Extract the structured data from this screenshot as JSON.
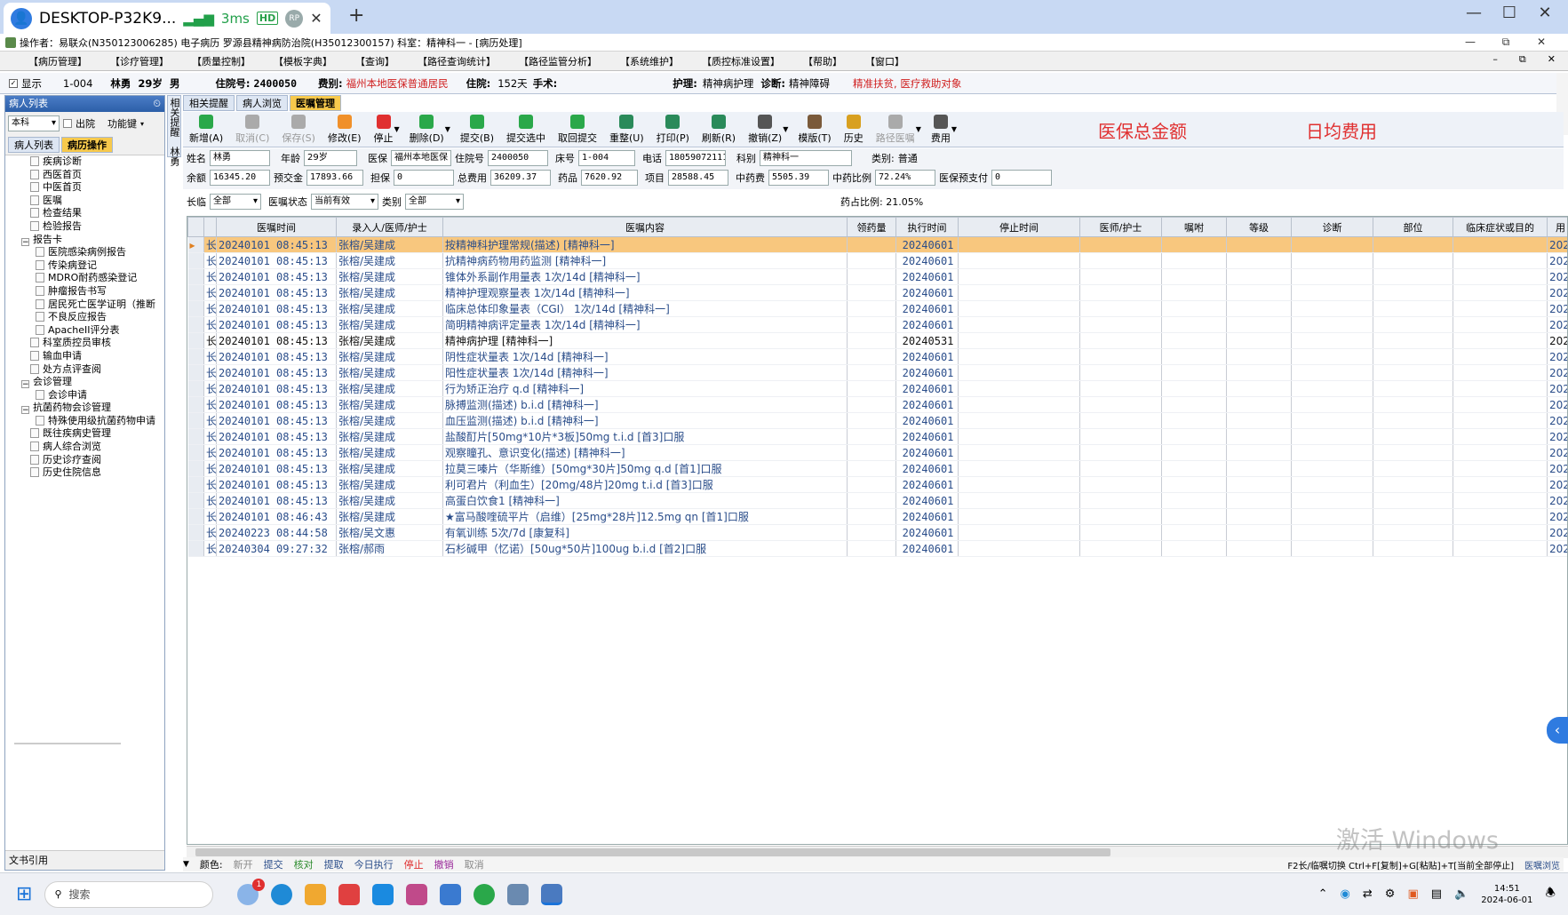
{
  "rdp": {
    "host": "DESKTOP-P32K9...",
    "ping": "3ms",
    "hd": "HD",
    "rp": "RP",
    "close": "✕",
    "add": "+"
  },
  "app_title": "操作者：易联众(N350123006285) 电子病历  罗源县精神病防治院(H35012300157)  科室：精神科一 - [病历处理]",
  "menu": [
    "【病历管理】",
    "【诊疗管理】",
    "【质量控制】",
    "【模板字典】",
    "【查询】",
    "【路径查询统计】",
    "【路径监管分析】",
    "【系统维护】",
    "【质控标准设置】",
    "【帮助】",
    "【窗口】"
  ],
  "patient_bar": {
    "show": "显示",
    "bed": "1-004",
    "name": "林勇",
    "age": "29岁",
    "sex": "男",
    "admission_no_label": "住院号:",
    "admission_no": "2400050",
    "fee_type_label": "费别:",
    "fee_type": "福州本地医保普通居民",
    "stay_label": "住院:",
    "stay": "152天",
    "surgery_label": "手术:",
    "nursing_label": "护理:",
    "nursing": "精神病护理",
    "diag_label": "诊断:",
    "diag": "精神障碍",
    "alert": "精准扶贫, 医疗救助对象"
  },
  "left": {
    "header": "病人列表",
    "dept_select": "本科",
    "discharged": "出院",
    "func_btn": "功能键",
    "tabs": [
      "病人列表",
      "病历操作"
    ],
    "tree": [
      {
        "label": "疾病诊断",
        "level": 1
      },
      {
        "label": "西医首页",
        "level": 1
      },
      {
        "label": "中医首页",
        "level": 1
      },
      {
        "label": "医嘱",
        "level": 1
      },
      {
        "label": "检查结果",
        "level": 1
      },
      {
        "label": "检验报告",
        "level": 1
      },
      {
        "label": "报告卡",
        "level": 0
      },
      {
        "label": "医院感染病例报告",
        "level": 2
      },
      {
        "label": "传染病登记",
        "level": 2
      },
      {
        "label": "MDRO耐药感染登记",
        "level": 2
      },
      {
        "label": "肿瘤报告书写",
        "level": 2
      },
      {
        "label": "居民死亡医学证明（推断",
        "level": 2
      },
      {
        "label": "不良反应报告",
        "level": 2
      },
      {
        "label": "ApacheII评分表",
        "level": 2
      },
      {
        "label": "科室质控员审核",
        "level": 1
      },
      {
        "label": "输血申请",
        "level": 1
      },
      {
        "label": "处方点评查阅",
        "level": 1
      },
      {
        "label": "会诊管理",
        "level": 0
      },
      {
        "label": "会诊申请",
        "level": 2
      },
      {
        "label": "抗菌药物会诊管理",
        "level": 0
      },
      {
        "label": "特殊使用级抗菌药物申请",
        "level": 2
      },
      {
        "label": "既往疾病史管理",
        "level": 1
      },
      {
        "label": "病人综合浏览",
        "level": 1
      },
      {
        "label": "历史诊疗查阅",
        "level": 1
      },
      {
        "label": "历史住院信息",
        "level": 1
      }
    ],
    "footer": "文书引用"
  },
  "vertical_tab": "相关提醒",
  "vertical_tab2": "林勇",
  "tabs": [
    "相关提醒",
    "病人浏览",
    "医嘱管理"
  ],
  "toolbar": [
    {
      "label": "新增(A)",
      "color": "#2aa84a",
      "disabled": false,
      "dd": false
    },
    {
      "label": "取消(C)",
      "color": "#aaaaaa",
      "disabled": true,
      "dd": false
    },
    {
      "label": "保存(S)",
      "color": "#aaaaaa",
      "disabled": true,
      "dd": false
    },
    {
      "label": "修改(E)",
      "color": "#f0902a",
      "disabled": false,
      "dd": false
    },
    {
      "label": "停止",
      "color": "#e03030",
      "disabled": false,
      "dd": true
    },
    {
      "label": "删除(D)",
      "color": "#2aa84a",
      "disabled": false,
      "dd": true
    },
    {
      "label": "提交(B)",
      "color": "#2aa84a",
      "disabled": false,
      "dd": false
    },
    {
      "label": "提交选中",
      "color": "#2aa84a",
      "disabled": false,
      "dd": false
    },
    {
      "label": "取回提交",
      "color": "#2aa84a",
      "disabled": false,
      "dd": false
    },
    {
      "label": "重整(U)",
      "color": "#2a8a5a",
      "disabled": false,
      "dd": false
    },
    {
      "label": "打印(P)",
      "color": "#2a8a5a",
      "disabled": false,
      "dd": false
    },
    {
      "label": "刷新(R)",
      "color": "#2a8a5a",
      "disabled": false,
      "dd": false
    },
    {
      "label": "撤销(Z)",
      "color": "#555555",
      "disabled": false,
      "dd": true
    },
    {
      "label": "模版(T)",
      "color": "#7a5a3a",
      "disabled": false,
      "dd": false
    },
    {
      "label": "历史",
      "color": "#d8a020",
      "disabled": false,
      "dd": false
    },
    {
      "label": "路径医嘱",
      "color": "#aaaaaa",
      "disabled": true,
      "dd": true
    },
    {
      "label": "费用",
      "color": "#555555",
      "disabled": false,
      "dd": true
    }
  ],
  "annotations": {
    "total_insurance": "医保总金额",
    "daily_cost": "日均费用"
  },
  "info": {
    "name_label": "姓名",
    "name": "林勇",
    "age_label": "年龄",
    "age": "29岁",
    "ins_label": "医保",
    "ins": "福州本地医保",
    "adm_label": "住院号",
    "adm": "2400050",
    "bed_label": "床号",
    "bed": "1-004",
    "phone_label": "电话",
    "phone": "18059072111",
    "dept_label": "科别",
    "dept": "精神科一",
    "cat_label": "类别:",
    "cat": "普通",
    "bal_label": "余额",
    "bal": "16345.20",
    "prepay_label": "预交金",
    "prepay": "17893.66",
    "guar_label": "担保",
    "guar": "0",
    "total_label": "总费用",
    "total": "36209.37",
    "drug_label": "药品",
    "drug": "7620.92",
    "item_label": "项目",
    "item": "28588.45",
    "tcm_label": "中药费",
    "tcm": "5505.39",
    "tcm_ratio_label": "中药比例",
    "tcm_ratio": "72.24%",
    "ins_prepay_label": "医保预支付",
    "ins_prepay": "0"
  },
  "filter": {
    "type_label": "长临",
    "type_val": "全部",
    "status_label": "医嘱状态",
    "status_val": "当前有效",
    "cat_label": "类别",
    "cat_val": "全部",
    "drug_ratio": "药占比例: 21.05%"
  },
  "grid": {
    "columns": [
      "",
      "",
      "医嘱时间",
      "录入人/医师/护士",
      "医嘱内容",
      "领药量",
      "执行时间",
      "停止时间",
      "医师/护士",
      "嘱咐",
      "等级",
      "诊断",
      "部位",
      "临床症状或目的",
      "用"
    ],
    "rows": [
      [
        "长",
        "20240101 08:45:13",
        "张榕/吴建成",
        "按精神科护理常规(描述)   [精神科一]",
        "20240601"
      ],
      [
        "长",
        "20240101 08:45:13",
        "张榕/吴建成",
        "抗精神病药物用药监测   [精神科一]",
        "20240601"
      ],
      [
        "长",
        "20240101 08:45:13",
        "张榕/吴建成",
        "锥体外系副作用量表  1次/14d  [精神科一]",
        "20240601"
      ],
      [
        "长",
        "20240101 08:45:13",
        "张榕/吴建成",
        "精神护理观察量表  1次/14d  [精神科一]",
        "20240601"
      ],
      [
        "长",
        "20240101 08:45:13",
        "张榕/吴建成",
        "临床总体印象量表（CGI）  1次/14d  [精神科一]",
        "20240601"
      ],
      [
        "长",
        "20240101 08:45:13",
        "张榕/吴建成",
        "简明精神病评定量表  1次/14d  [精神科一]",
        "20240601"
      ],
      [
        "长",
        "20240101 08:45:13",
        "张榕/吴建成",
        "精神病护理   [精神科一]",
        "20240531"
      ],
      [
        "长",
        "20240101 08:45:13",
        "张榕/吴建成",
        "阴性症状量表  1次/14d  [精神科一]",
        "20240601"
      ],
      [
        "长",
        "20240101 08:45:13",
        "张榕/吴建成",
        "阳性症状量表  1次/14d  [精神科一]",
        "20240601"
      ],
      [
        "长",
        "20240101 08:45:13",
        "张榕/吴建成",
        "行为矫正治疗  q.d  [精神科一]",
        "20240601"
      ],
      [
        "长",
        "20240101 08:45:13",
        "张榕/吴建成",
        "脉搏监测(描述)  b.i.d  [精神科一]",
        "20240601"
      ],
      [
        "长",
        "20240101 08:45:13",
        "张榕/吴建成",
        "血压监测(描述)  b.i.d  [精神科一]",
        "20240601"
      ],
      [
        "长",
        "20240101 08:45:13",
        "张榕/吴建成",
        "盐酸酊片[50mg*10片*3板]50mg t.i.d [首3]口服",
        "20240601"
      ],
      [
        "长",
        "20240101 08:45:13",
        "张榕/吴建成",
        "观察瞳孔、意识变化(描述)    [精神科一]",
        "20240601"
      ],
      [
        "长",
        "20240101 08:45:13",
        "张榕/吴建成",
        "拉莫三嗪片（华斯维）[50mg*30片]50mg q.d [首1]口服",
        "20240601"
      ],
      [
        "长",
        "20240101 08:45:13",
        "张榕/吴建成",
        "利可君片（利血生）[20mg/48片]20mg t.i.d [首3]口服",
        "20240601"
      ],
      [
        "长",
        "20240101 08:45:13",
        "张榕/吴建成",
        "高蛋白饮食1   [精神科一]",
        "20240601"
      ],
      [
        "长",
        "20240101 08:46:43",
        "张榕/吴建成",
        "★富马酸喹硫平片（启维）[25mg*28片]12.5mg qn [首1]口服",
        "20240601"
      ],
      [
        "长",
        "20240223 08:44:58",
        "张榕/吴文惠",
        "有氧训练  5次/7d  [康复科]",
        "20240601"
      ],
      [
        "长",
        "20240304 09:27:32",
        "张榕/郝雨",
        "石杉碱甲（忆诺）[50ug*50片]100ug b.i.d [首2]口服",
        "20240601"
      ]
    ],
    "col_tail": "202"
  },
  "legend": {
    "label": "颜色:",
    "items": [
      {
        "t": "新开",
        "c": "#888888"
      },
      {
        "t": "提交",
        "c": "#2a4d8a"
      },
      {
        "t": "核对",
        "c": "#2a8a2a"
      },
      {
        "t": "提取",
        "c": "#2a4d8a"
      },
      {
        "t": "今日执行",
        "c": "#2a4d8a"
      },
      {
        "t": "停止",
        "c": "#e03030"
      },
      {
        "t": "撤销",
        "c": "#9a2a9a"
      },
      {
        "t": "取消",
        "c": "#888888"
      }
    ],
    "hint": "F2长/临嘱切换 Ctrl+F[复制]+G[粘贴]+T[当前全部停止]",
    "hint2": "医嘱浏览"
  },
  "watermark": "激活 Windows",
  "taskbar": {
    "search": "搜索",
    "time": "14:51",
    "date": "2024-06-01",
    "badge": "1"
  }
}
